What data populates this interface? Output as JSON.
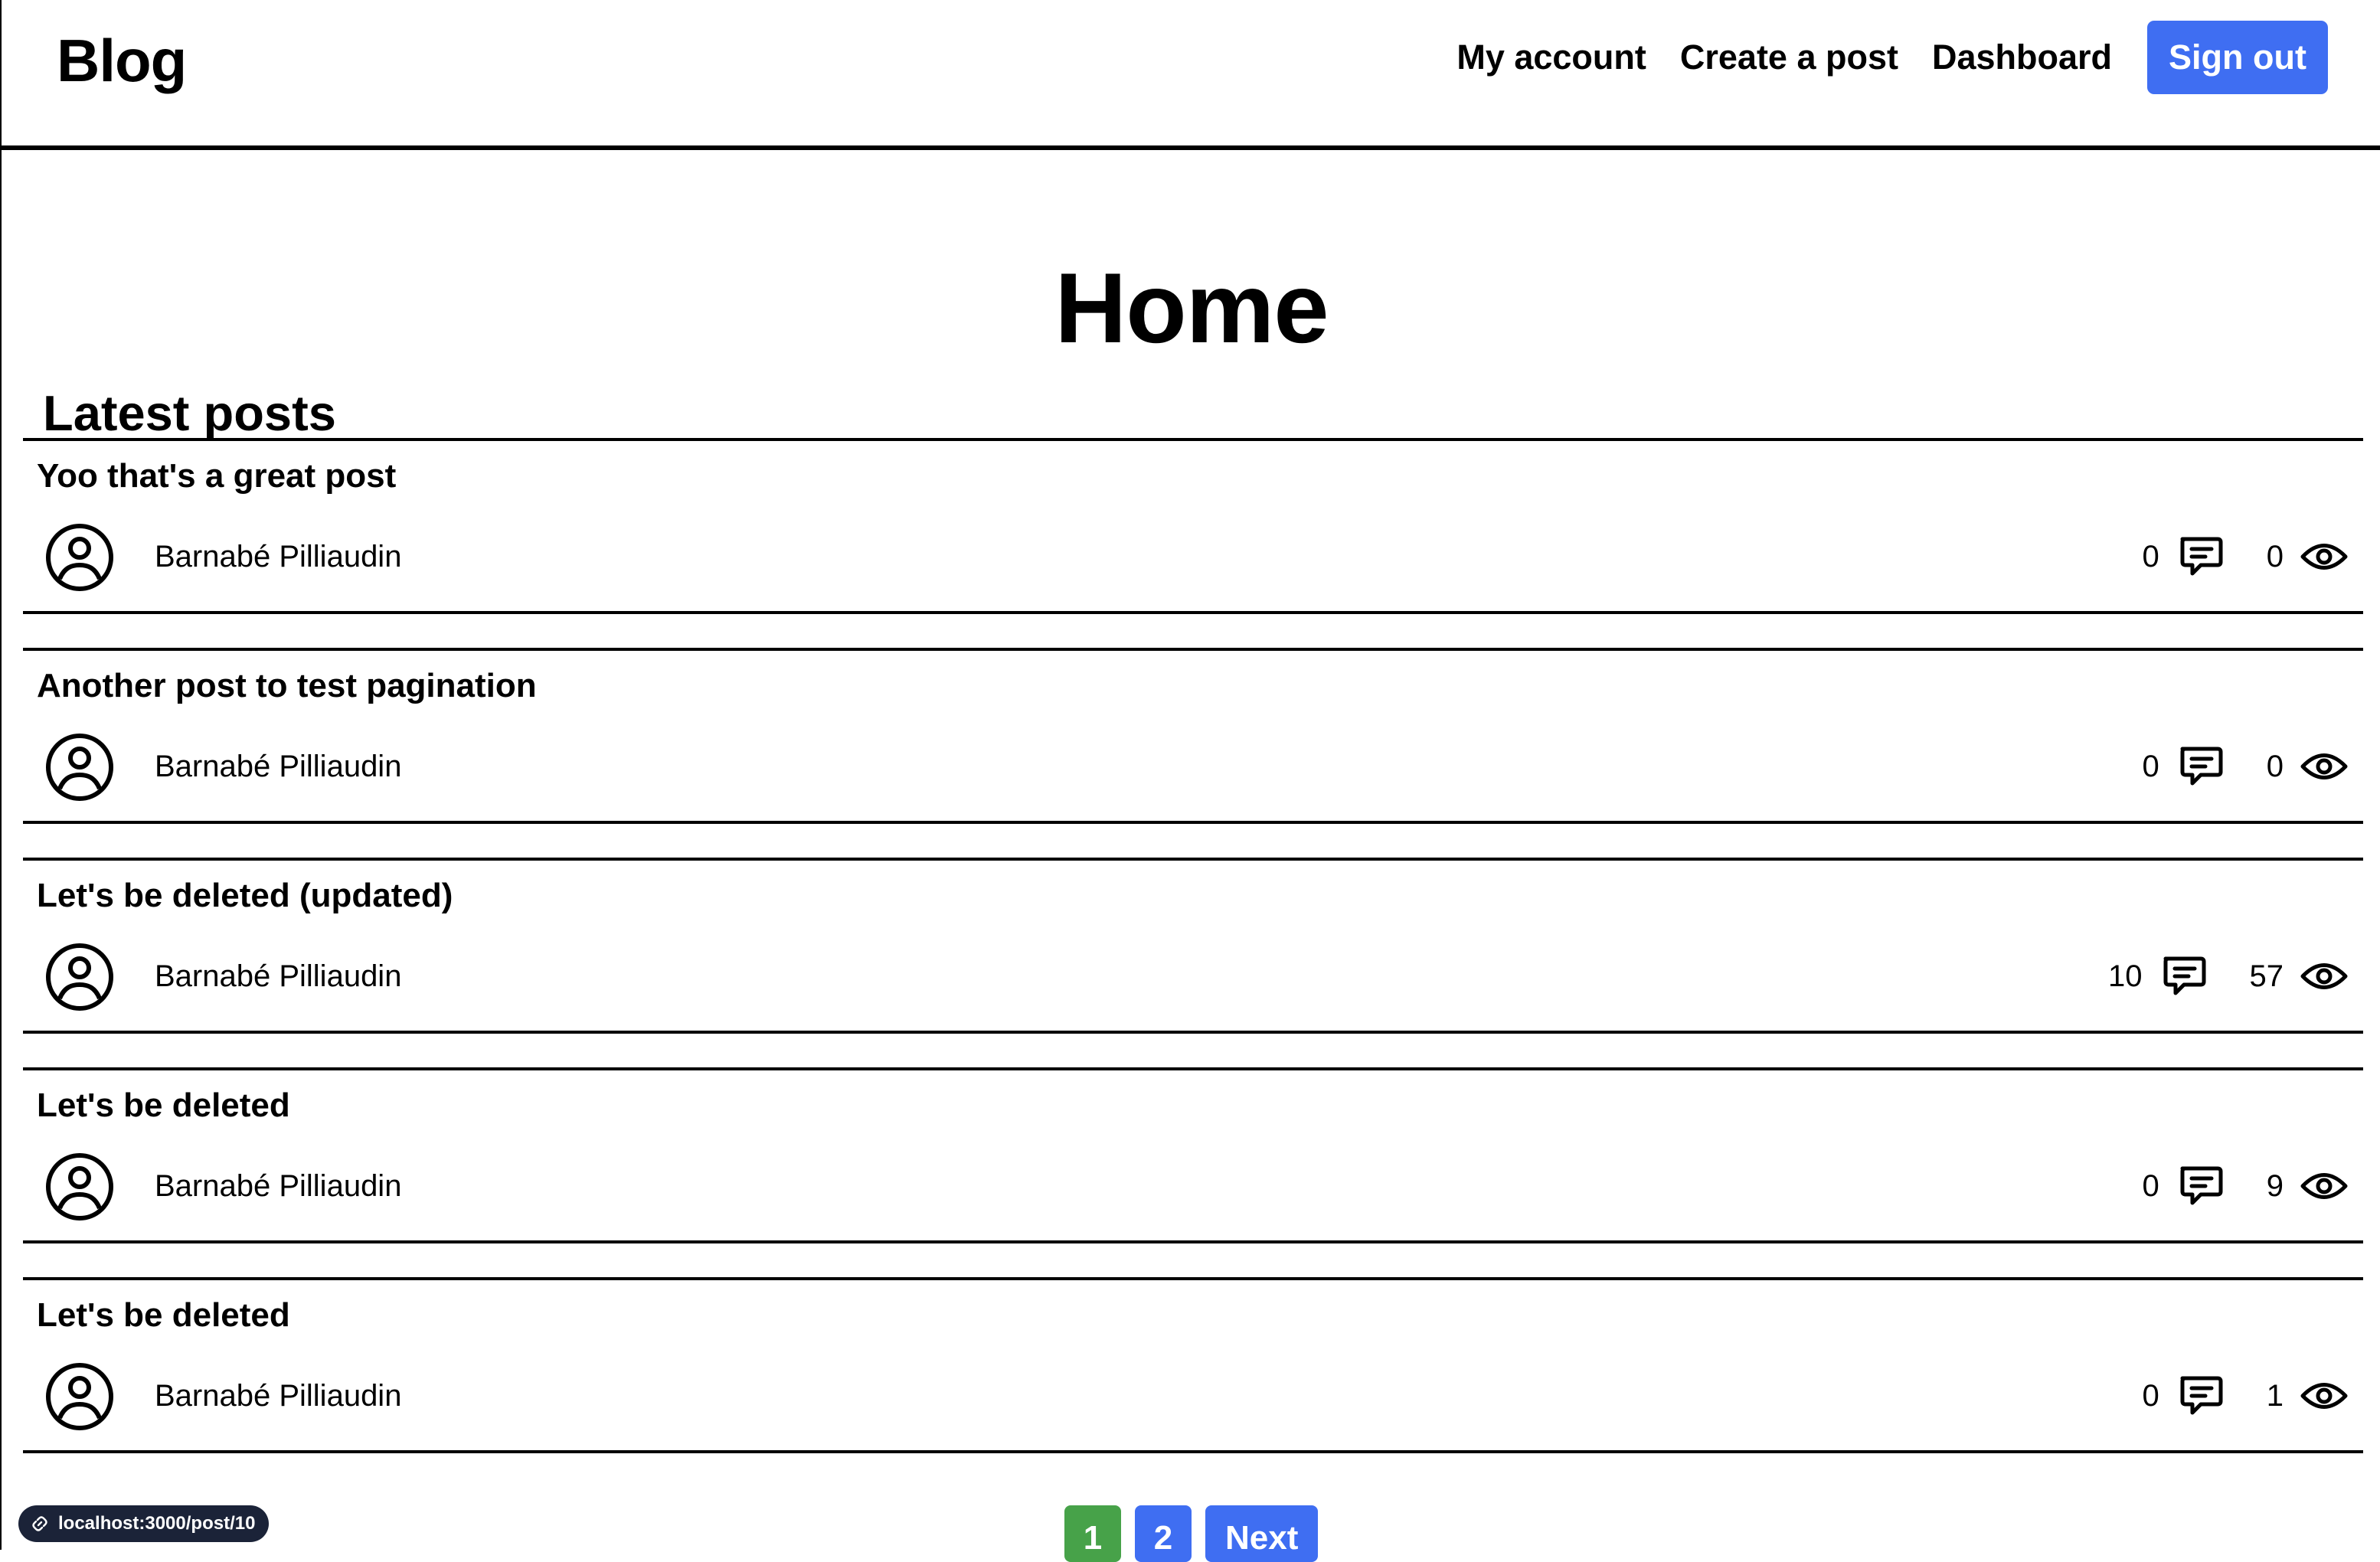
{
  "header": {
    "brand": "Blog",
    "nav": {
      "my_account": "My account",
      "create_post": "Create a post",
      "dashboard": "Dashboard",
      "sign_out": "Sign out"
    }
  },
  "main": {
    "title": "Home",
    "section_title": "Latest posts",
    "posts": [
      {
        "title": "Yoo that's a great post",
        "author": "Barnabé Pilliaudin",
        "comments": "0",
        "views": "0"
      },
      {
        "title": "Another post to test pagination",
        "author": "Barnabé Pilliaudin",
        "comments": "0",
        "views": "0"
      },
      {
        "title": "Let's be deleted (updated)",
        "author": "Barnabé Pilliaudin",
        "comments": "10",
        "views": "57"
      },
      {
        "title": "Let's be deleted",
        "author": "Barnabé Pilliaudin",
        "comments": "0",
        "views": "9"
      },
      {
        "title": "Let's be deleted",
        "author": "Barnabé Pilliaudin",
        "comments": "0",
        "views": "1"
      }
    ]
  },
  "pagination": {
    "current_page": "1",
    "page_2": "2",
    "next": "Next"
  },
  "status_bar": {
    "url": "localhost:3000/post/10"
  },
  "icons": {
    "avatar": "user-circle-icon",
    "comments": "chat-bubble-icon",
    "views": "eye-icon",
    "status": "link-icon"
  },
  "colors": {
    "primary": "#3f6ef2",
    "current_page": "#47a249",
    "status_chip": "#1b2338"
  }
}
